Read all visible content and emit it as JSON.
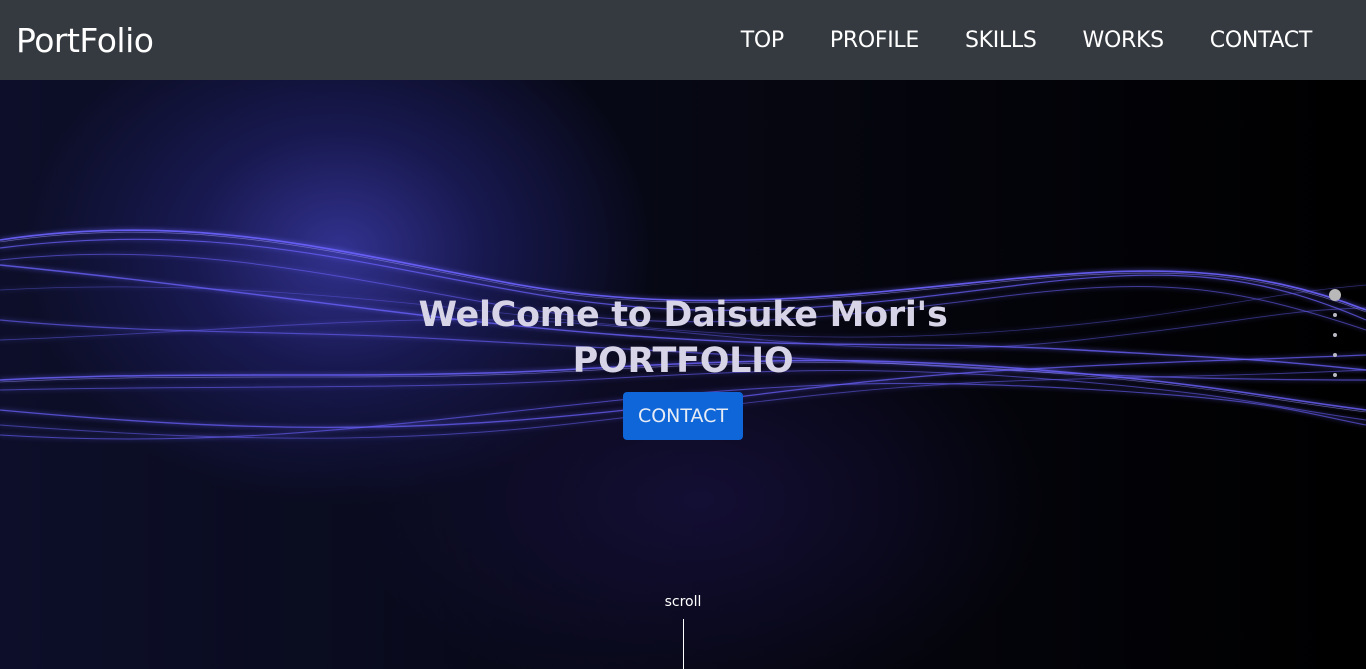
{
  "header": {
    "brand": "PortFolio",
    "nav": [
      "TOP",
      "PROFILE",
      "SKILLS",
      "WORKS",
      "CONTACT"
    ]
  },
  "hero": {
    "title_line1": "WelCome to Daisuke Mori's",
    "title_line2": "PORTFOLIO",
    "cta_label": "CONTACT",
    "scroll_label": "scroll",
    "pager": {
      "count": 5,
      "active_index": 0
    }
  },
  "colors": {
    "navbar_bg": "#343a40",
    "cta_bg": "#0e66d8",
    "wave": "#6b63ff"
  }
}
